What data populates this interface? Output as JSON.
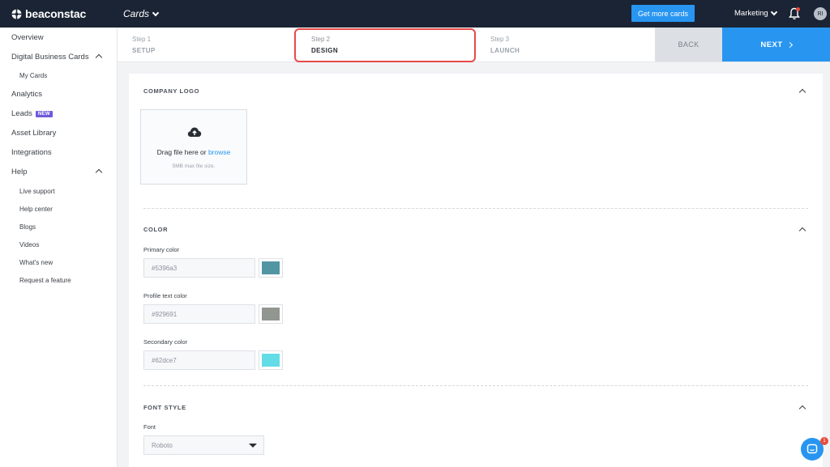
{
  "topbar": {
    "logo_text": "beaconstac",
    "product_label": "Cards",
    "get_more_label": "Get more cards",
    "workspace_label": "Marketing",
    "avatar_initials": "RI"
  },
  "sidebar": {
    "overview": "Overview",
    "digital_business_cards": "Digital Business Cards",
    "my_cards": "My Cards",
    "analytics": "Analytics",
    "leads": "Leads",
    "leads_badge": "NEW",
    "asset_library": "Asset Library",
    "integrations": "Integrations",
    "help": "Help",
    "help_items": [
      "Live support",
      "Help center",
      "Blogs",
      "Videos",
      "What's new",
      "Request a feature"
    ]
  },
  "stepper": {
    "steps": [
      {
        "num": "Step 1",
        "title": "SETUP"
      },
      {
        "num": "Step 2",
        "title": "DESIGN"
      },
      {
        "num": "Step 3",
        "title": "LAUNCH"
      }
    ],
    "back_label": "BACK",
    "next_label": "NEXT"
  },
  "logo_section": {
    "title": "COMPANY LOGO",
    "drop_text": "Drag file here or ",
    "browse_link": "browse",
    "hint": "5MB max file size."
  },
  "color_section": {
    "title": "COLOR",
    "fields": [
      {
        "label": "Primary color",
        "value": "#5396a3",
        "swatch": "#5396a3"
      },
      {
        "label": "Profile text color",
        "value": "#929691",
        "swatch": "#929691"
      },
      {
        "label": "Secondary color",
        "value": "#62dce7",
        "swatch": "#62dce7"
      }
    ]
  },
  "font_section": {
    "title": "FONT STYLE",
    "font_label": "Font",
    "font_value": "Roboto"
  },
  "chat": {
    "unread": "1"
  },
  "colors": {
    "accent": "#2895f1",
    "topbar": "#1b2434",
    "highlight": "#e84a4a"
  }
}
